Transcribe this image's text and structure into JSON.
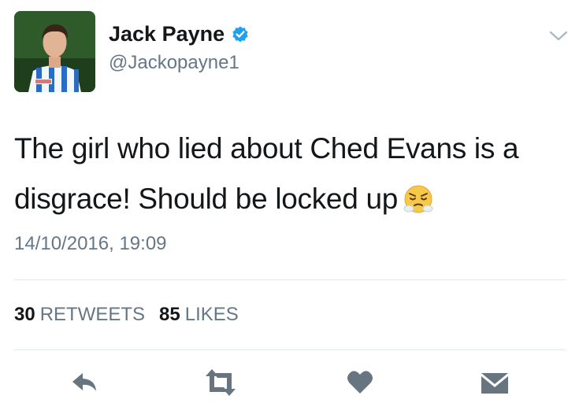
{
  "user": {
    "name": "Jack Payne",
    "handle": "@Jackopayne1",
    "verified": true,
    "avatar_icon": "profile-photo-football-kit"
  },
  "tweet": {
    "text": "The girl who lied about Ched Evans is a disgrace! Should be locked up",
    "emoji": "face-with-steam-from-nose",
    "timestamp": "14/10/2016, 19:09"
  },
  "stats": {
    "retweets_count": "30",
    "retweets_label": "RETWEETS",
    "likes_count": "85",
    "likes_label": "LIKES"
  },
  "actions": [
    "reply-icon",
    "retweet-icon",
    "heart-icon",
    "envelope-icon"
  ],
  "colors": {
    "text": "#14171a",
    "secondary": "#657786",
    "verified_blue": "#1da1f2",
    "action_icons": "#66757f",
    "divider": "#e1e8ed"
  }
}
